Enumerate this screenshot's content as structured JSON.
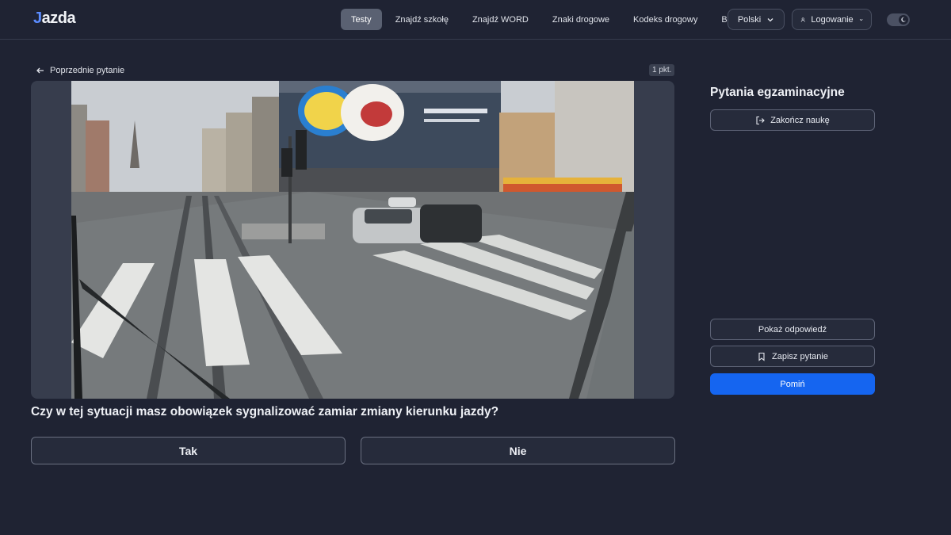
{
  "header": {
    "logo_mark": "J",
    "logo_text": "azda",
    "nav": [
      {
        "label": "Testy",
        "active": true
      },
      {
        "label": "Znajdź szkołę",
        "active": false
      },
      {
        "label": "Znajdź WORD",
        "active": false
      },
      {
        "label": "Znaki drogowe",
        "active": false
      },
      {
        "label": "Kodeks drogowy",
        "active": false
      },
      {
        "label": "Blog",
        "active": false
      }
    ],
    "language_label": "Polski",
    "login_label": "Logowanie",
    "theme": "dark"
  },
  "question_view": {
    "prev_label": "Poprzednie pytanie",
    "points_badge": "1 pkt.",
    "question_text": "Czy w tej sytuacji masz obowiązek sygnalizować zamiar zmiany kierunku jazdy?",
    "answers": [
      "Tak",
      "Nie"
    ]
  },
  "side_panel": {
    "title": "Pytania egzaminacyjne",
    "finish_label": "Zakończ naukę",
    "show_answer_label": "Pokaż odpowiedź",
    "save_label": "Zapisz pytanie",
    "skip_label": "Pomiń"
  },
  "colors": {
    "background": "#1f2333",
    "accent": "#1565f0",
    "nav_active": "#5a6172"
  }
}
